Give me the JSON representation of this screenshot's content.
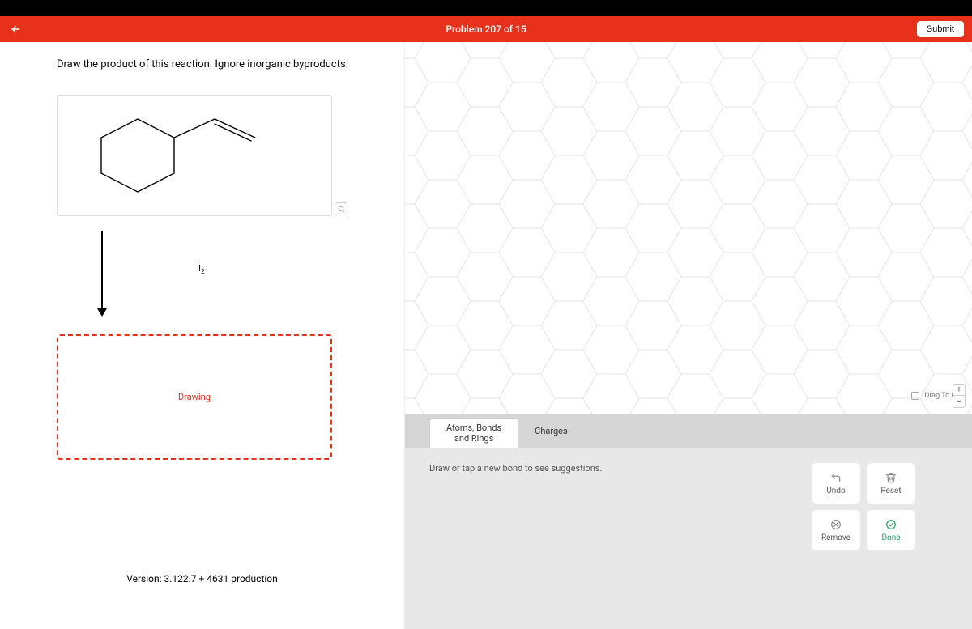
{
  "header": {
    "title": "Problem 207 of 15",
    "submit": "Submit"
  },
  "left": {
    "prompt": "Draw the product of this reaction.  Ignore inorganic byproducts.",
    "reagent_symbol": "I",
    "reagent_sub": "2",
    "drawing_label": "Drawing",
    "version": "Version: 3.122.7 + 4631 production"
  },
  "canvas": {
    "drag_to_pan": "Drag To Pan"
  },
  "tabs": {
    "atoms_line1": "Atoms, Bonds",
    "atoms_line2": "and Rings",
    "charges": "Charges"
  },
  "tools": {
    "hint": "Draw or tap a new bond to see suggestions.",
    "undo": "Undo",
    "reset": "Reset",
    "remove": "Remove",
    "done": "Done"
  }
}
